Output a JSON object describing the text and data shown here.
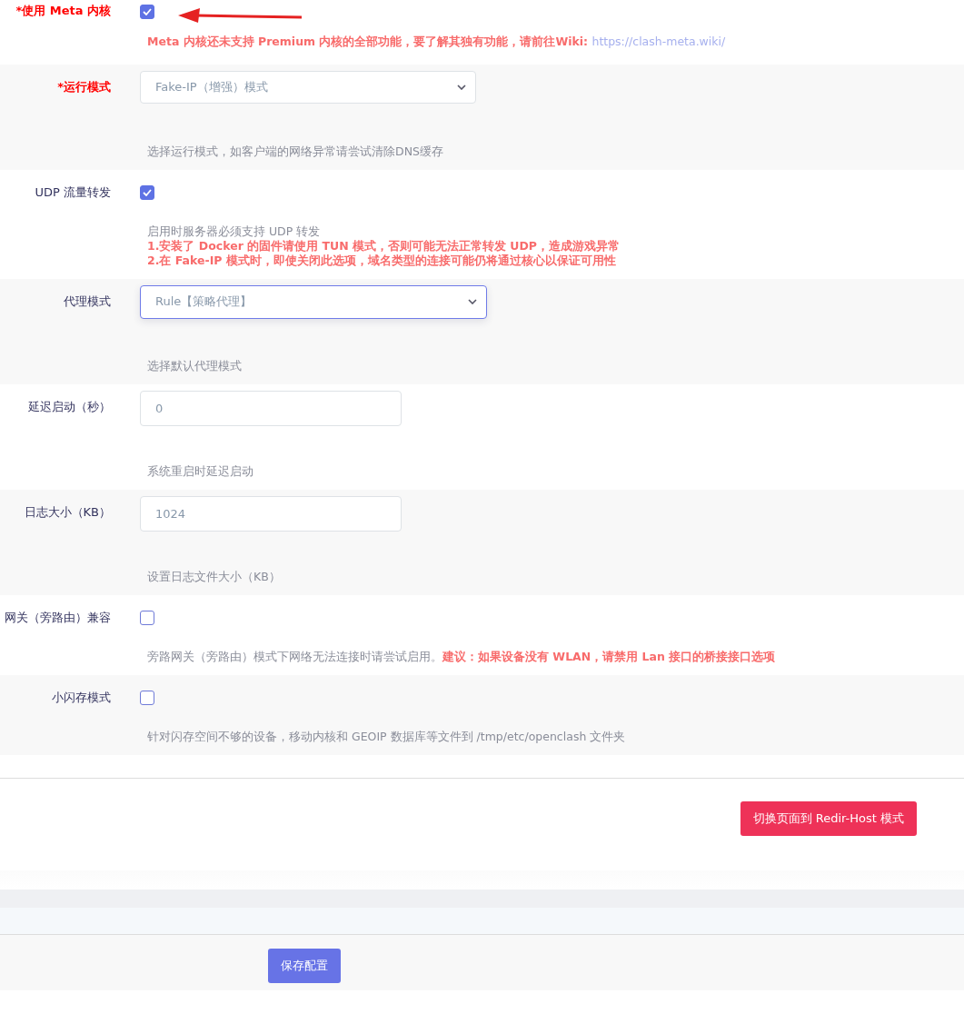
{
  "rows": [
    {
      "label": "*使用 Meta 内核",
      "required": true,
      "kind": "checkbox",
      "checked": true,
      "annotated": true,
      "description": [
        {
          "kind": "warn",
          "text": "Meta 内核还未支持 Premium 内核的全部功能，要了解其独有功能，请前往Wiki:",
          "link": "https://clash-meta.wiki/"
        }
      ]
    },
    {
      "label": "*运行模式",
      "required": true,
      "kind": "select",
      "value": "Fake-IP（增强）模式",
      "focused": false,
      "annotated": false,
      "description": [
        {
          "kind": "plain",
          "text": "选择运行模式，如客户端的网络异常请尝试清除DNS缓存"
        }
      ]
    },
    {
      "label": "UDP 流量转发",
      "required": false,
      "kind": "checkbox",
      "checked": true,
      "annotated": false,
      "description": [
        {
          "kind": "plain",
          "text": "启用时服务器必须支持 UDP 转发"
        },
        {
          "kind": "warn",
          "text": "1.安装了 Docker 的固件请使用 TUN 模式，否则可能无法正常转发 UDP，造成游戏异常"
        },
        {
          "kind": "warn",
          "text": "2.在 Fake-IP 模式时，即使关闭此选项，域名类型的连接可能仍将通过核心以保证可用性"
        }
      ]
    },
    {
      "label": "代理模式",
      "required": false,
      "kind": "select",
      "value": "Rule【策略代理】",
      "focused": true,
      "annotated": false,
      "description": [
        {
          "kind": "plain",
          "text": "选择默认代理模式"
        }
      ]
    },
    {
      "label": "延迟启动（秒）",
      "required": false,
      "kind": "input",
      "value": "0",
      "annotated": false,
      "description": [
        {
          "kind": "plain",
          "text": "系统重启时延迟启动"
        }
      ]
    },
    {
      "label": "日志大小（KB）",
      "required": false,
      "kind": "input",
      "value": "1024",
      "annotated": false,
      "description": [
        {
          "kind": "plain",
          "text": "设置日志文件大小（KB）"
        }
      ]
    },
    {
      "label": "网关（旁路由）兼容",
      "required": false,
      "kind": "checkbox",
      "checked": false,
      "annotated": false,
      "description": [
        {
          "kind": "plain",
          "text": "旁路网关（旁路由）模式下网络无法连接时请尝试启用。**建议：如果设备没有 WLAN，请禁用 Lan 接口的桥接接口选项**"
        }
      ]
    },
    {
      "label": "小闪存模式",
      "required": false,
      "kind": "checkbox",
      "checked": false,
      "annotated": false,
      "description": [
        {
          "kind": "plain",
          "text": "针对闪存空间不够的设备，移动内核和 GEOIP 数据库等文件到 /tmp/etc/openclash 文件夹"
        }
      ]
    }
  ],
  "switch_button": "切换页面到 Redir-Host 模式",
  "save_button": "保存配置"
}
